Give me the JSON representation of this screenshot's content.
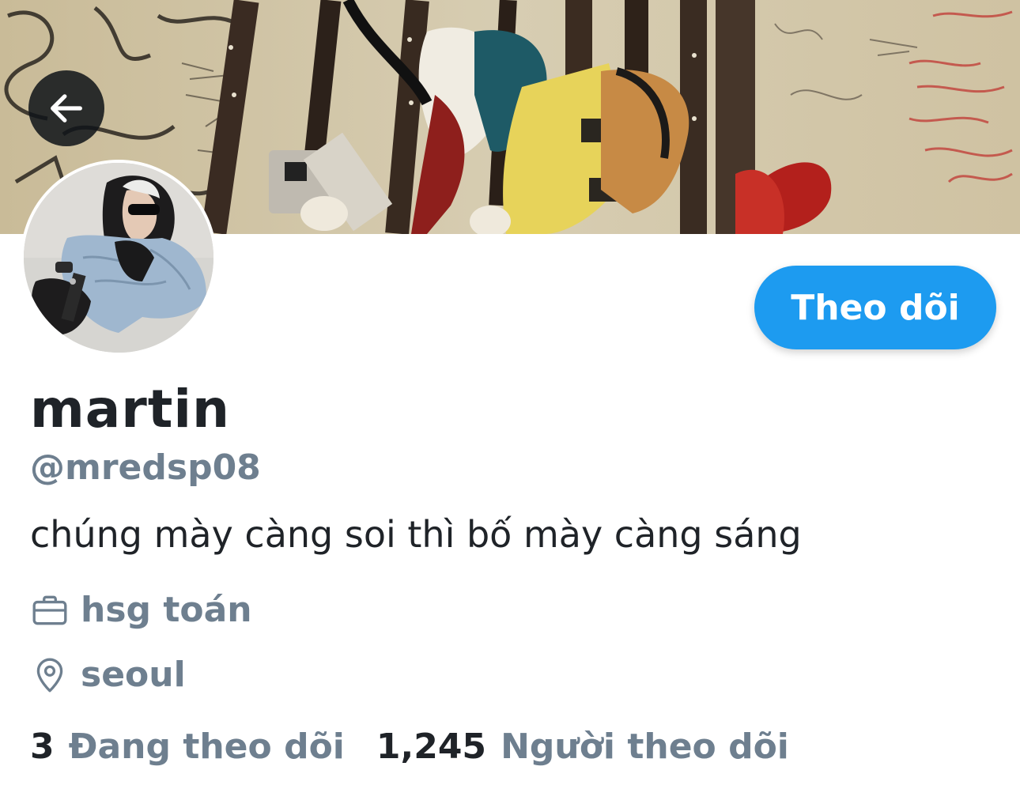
{
  "header": {
    "back_icon": "arrow-left-icon",
    "banner_image": "guitars-on-graffiti-wall",
    "avatar_image": "person-in-hoodie-and-sunglasses"
  },
  "profile": {
    "display_name": "martin",
    "handle": "@mredsp08",
    "bio": "chúng mày càng soi thì bố mày càng sáng",
    "work_icon": "briefcase-icon",
    "work": "hsg toán",
    "location_icon": "location-pin-icon",
    "location": "seoul"
  },
  "actions": {
    "follow_label": "Theo dõi"
  },
  "stats": {
    "following_count": "3",
    "following_label": "Đang theo dõi",
    "followers_count": "1,245",
    "followers_label": "Người theo dõi"
  },
  "colors": {
    "accent": "#1d9bf0",
    "primary_text": "#1f2328",
    "secondary_text": "#6e7f8f"
  }
}
